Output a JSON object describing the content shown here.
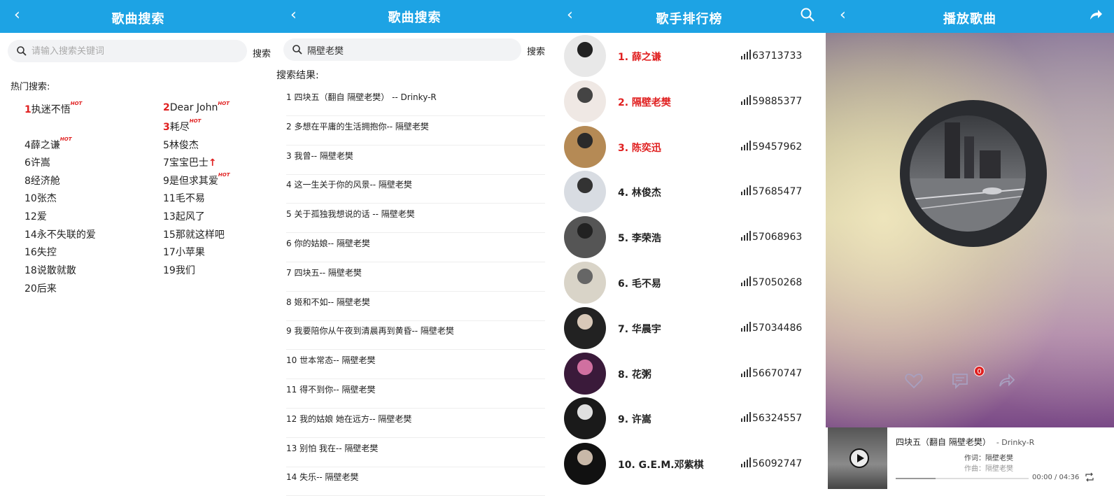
{
  "search_panel": {
    "title": "歌曲搜索",
    "search_placeholder": "请输入搜索关键词",
    "search_button": "搜索",
    "hot_label": "热门搜索:",
    "hot_badge": "HOT",
    "hot_items": [
      {
        "num": "1",
        "text": "执迷不悟",
        "badge": "hot"
      },
      {
        "num": "2",
        "text": "Dear John",
        "badge": "hot"
      },
      {
        "num": "3",
        "text": "耗尽",
        "badge": "hot"
      },
      {
        "num": "4",
        "text": "薛之谦",
        "badge": "hot"
      },
      {
        "num": "5",
        "text": "林俊杰",
        "badge": ""
      },
      {
        "num": "6",
        "text": "许嵩",
        "badge": ""
      },
      {
        "num": "7",
        "text": "宝宝巴士",
        "badge": "up"
      },
      {
        "num": "8",
        "text": "经济舱",
        "badge": ""
      },
      {
        "num": "9",
        "text": "是但求其爱",
        "badge": "hot"
      },
      {
        "num": "10",
        "text": "张杰",
        "badge": ""
      },
      {
        "num": "11",
        "text": "毛不易",
        "badge": ""
      },
      {
        "num": "12",
        "text": "爱",
        "badge": ""
      },
      {
        "num": "13",
        "text": "起风了",
        "badge": ""
      },
      {
        "num": "14",
        "text": "永不失联的爱",
        "badge": ""
      },
      {
        "num": "15",
        "text": "那就这样吧",
        "badge": ""
      },
      {
        "num": "16",
        "text": "失控",
        "badge": ""
      },
      {
        "num": "17",
        "text": "小苹果",
        "badge": ""
      },
      {
        "num": "18",
        "text": "说散就散",
        "badge": ""
      },
      {
        "num": "19",
        "text": "我们",
        "badge": ""
      },
      {
        "num": "20",
        "text": "后来",
        "badge": ""
      }
    ]
  },
  "results_panel": {
    "title": "歌曲搜索",
    "search_value": "隔壁老樊",
    "search_button": "搜索",
    "results_label": "搜索结果:",
    "results": [
      "1 四块五（翻自 隔壁老樊） -- Drinky-R",
      "2 多想在平庸的生活拥抱你-- 隔壁老樊",
      "3 我曾-- 隔壁老樊",
      "4 这一生关于你的风景-- 隔壁老樊",
      "5 关于孤独我想说的话 -- 隔壁老樊",
      "6 你的姑娘-- 隔壁老樊",
      "7 四块五-- 隔壁老樊",
      "8 姬和不如-- 隔壁老樊",
      "9 我要陪你从午夜到清晨再到黄昏-- 隔壁老樊",
      "10 世本常态-- 隔壁老樊",
      "11 得不到你-- 隔壁老樊",
      "12 我的姑娘 她在远方-- 隔壁老樊",
      "13 别怕 我在-- 隔壁老樊",
      "14 失乐-- 隔壁老樊"
    ]
  },
  "singers_panel": {
    "title": "歌手排行榜",
    "singers": [
      {
        "name": "1. 薛之谦",
        "count": "63713733",
        "highlight": true
      },
      {
        "name": "2. 隔壁老樊",
        "count": "59885377",
        "highlight": true
      },
      {
        "name": "3. 陈奕迅",
        "count": "59457962",
        "highlight": true
      },
      {
        "name": "4. 林俊杰",
        "count": "57685477",
        "highlight": false
      },
      {
        "name": "5. 李荣浩",
        "count": "57068963",
        "highlight": false
      },
      {
        "name": "6. 毛不易",
        "count": "57050268",
        "highlight": false
      },
      {
        "name": "7. 华晨宇",
        "count": "57034486",
        "highlight": false
      },
      {
        "name": "8. 花粥",
        "count": "56670747",
        "highlight": false
      },
      {
        "name": "9. 许嵩",
        "count": "56324557",
        "highlight": false
      },
      {
        "name": "10. G.E.M.邓紫棋",
        "count": "56092747",
        "highlight": false
      }
    ]
  },
  "player_panel": {
    "title": "播放歌曲",
    "comment_count": "0",
    "song_title": "四块五（翻自 隔壁老樊）",
    "artist": "- Drinky-R",
    "lyricist": "作词：隔壁老樊",
    "composer": "作曲：隔壁老樊",
    "time": "00:00 / 04:36",
    "progress": 0.3
  },
  "colors": {
    "accent": "#1da3e4",
    "highlight": "#e02020"
  }
}
